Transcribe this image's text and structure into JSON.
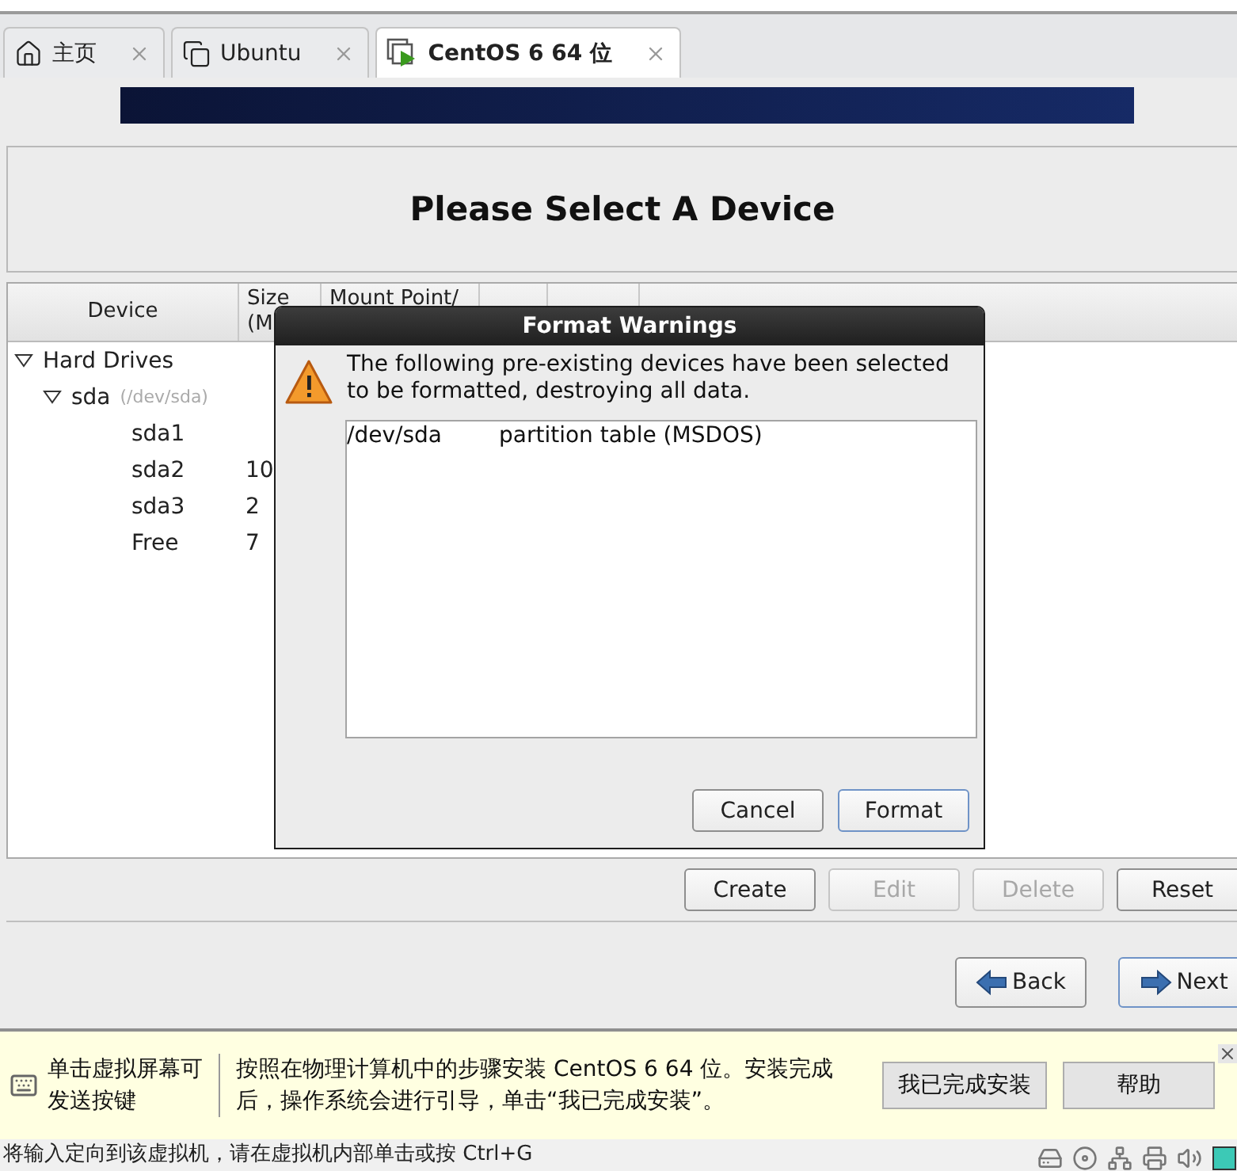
{
  "tabs": [
    {
      "label": "主页",
      "kind": "home",
      "selected": false
    },
    {
      "label": "Ubuntu",
      "kind": "vm",
      "selected": false
    },
    {
      "label": "CentOS 6 64 位",
      "kind": "running-vm",
      "selected": true
    }
  ],
  "installer": {
    "heading": "Please Select A Device",
    "table": {
      "columns": [
        "Device",
        "Size (M",
        "Mount Point/"
      ],
      "rows": [
        {
          "name": "Hard Drives",
          "expanded": true,
          "children": [
            {
              "name": "sda",
              "path": "(/dev/sda)",
              "expanded": true,
              "children": [
                {
                  "name": "sda1"
                },
                {
                  "name": "sda2",
                  "size": "10"
                },
                {
                  "name": "sda3",
                  "size": "2"
                },
                {
                  "name": "Free",
                  "size": "7"
                }
              ]
            }
          ]
        }
      ]
    },
    "actions": [
      {
        "label": "Create",
        "disabled": false
      },
      {
        "label": "Edit",
        "disabled": true
      },
      {
        "label": "Delete",
        "disabled": true
      },
      {
        "label": "Reset",
        "disabled": false
      }
    ],
    "nav": [
      {
        "label": "Back",
        "kind": "back",
        "focused": false
      },
      {
        "label": "Next",
        "kind": "next",
        "focused": true
      }
    ]
  },
  "dialog": {
    "title": "Format Warnings",
    "message": "The following pre-existing devices have been selected to be formatted, destroying all data.",
    "items": [
      {
        "device": "/dev/sda",
        "description": "partition table (MSDOS)"
      }
    ],
    "buttons": [
      {
        "label": "Cancel",
        "focused": false
      },
      {
        "label": "Format",
        "focused": true
      }
    ]
  },
  "hint_bar": {
    "keyboard_hint": "单击虚拟屏幕可发送按键",
    "message": "按照在物理计算机中的步骤安装 CentOS 6 64 位。安装完成后，操作系统会进行引导，单击“我已完成安装”。",
    "buttons": [
      "我已完成安装",
      "帮助"
    ]
  },
  "status_bar": {
    "text": "将输入定向到该虚拟机，请在虚拟机内部单击或按 Ctrl+G"
  }
}
